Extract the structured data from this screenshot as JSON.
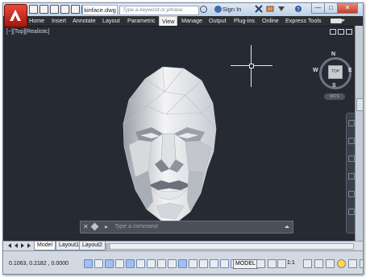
{
  "window": {
    "doc_title": "kinface.dwg",
    "search_placeholder": "Type a keyword or phrase",
    "sign_in": "Sign In",
    "minimize": "—",
    "restore": "□",
    "close": "✕"
  },
  "ribbon": {
    "tabs": [
      "Home",
      "Insert",
      "Annotate",
      "Layout",
      "Parametric",
      "View",
      "Manage",
      "Output",
      "Plug-ins",
      "Online",
      "Express Tools"
    ],
    "active_tab": "View"
  },
  "viewport": {
    "label": "[−][Top][Realistic]",
    "viewcube": {
      "face": "TOP",
      "north": "N",
      "south": "S",
      "east": "E",
      "west": "W"
    },
    "wcs": "WCS"
  },
  "command_line": {
    "placeholder": "Type a command"
  },
  "layout_tabs": [
    "Model",
    "Layout1",
    "Layout2"
  ],
  "status": {
    "coordinates": "0.1063, 0.2182 , 0.0000",
    "model": "MODEL",
    "scale": "1:1"
  },
  "colors": {
    "ribbon": "#2d2f33",
    "viewport": "#252a33",
    "app_button": "#c4261a"
  }
}
